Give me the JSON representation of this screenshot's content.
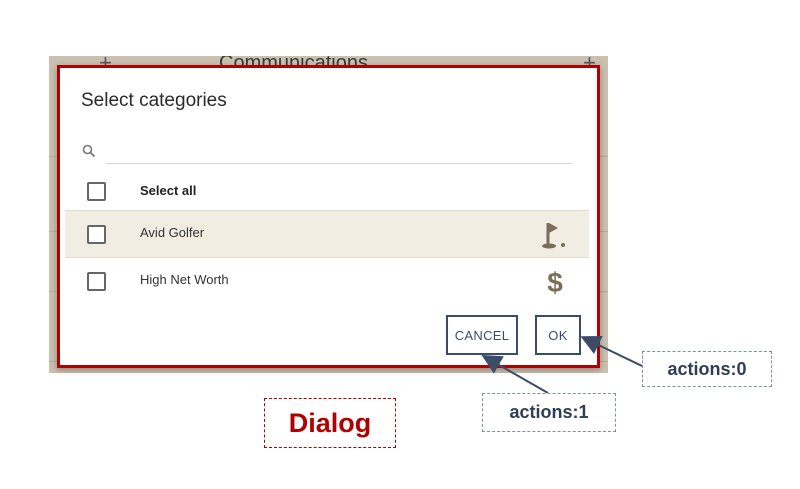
{
  "background": {
    "title": "Communications"
  },
  "dialog": {
    "title": "Select categories",
    "search": {
      "value": "",
      "placeholder": ""
    },
    "select_all_label": "Select all",
    "items": [
      {
        "label": "Avid Golfer",
        "icon": "golf-flag-icon",
        "checked": false,
        "selected": true
      },
      {
        "label": "High Net Worth",
        "icon": "dollar-icon",
        "checked": false,
        "selected": false
      }
    ],
    "actions": {
      "cancel_label": "CANCEL",
      "ok_label": "OK"
    }
  },
  "annotations": {
    "dialog_label": "Dialog",
    "ok_callout": "actions:0",
    "cancel_callout": "actions:1"
  },
  "colors": {
    "dialog_border": "#b00000",
    "button_border": "#3b4d66",
    "selected_row": "#f1ede2",
    "icon_color": "#7a6f55"
  }
}
